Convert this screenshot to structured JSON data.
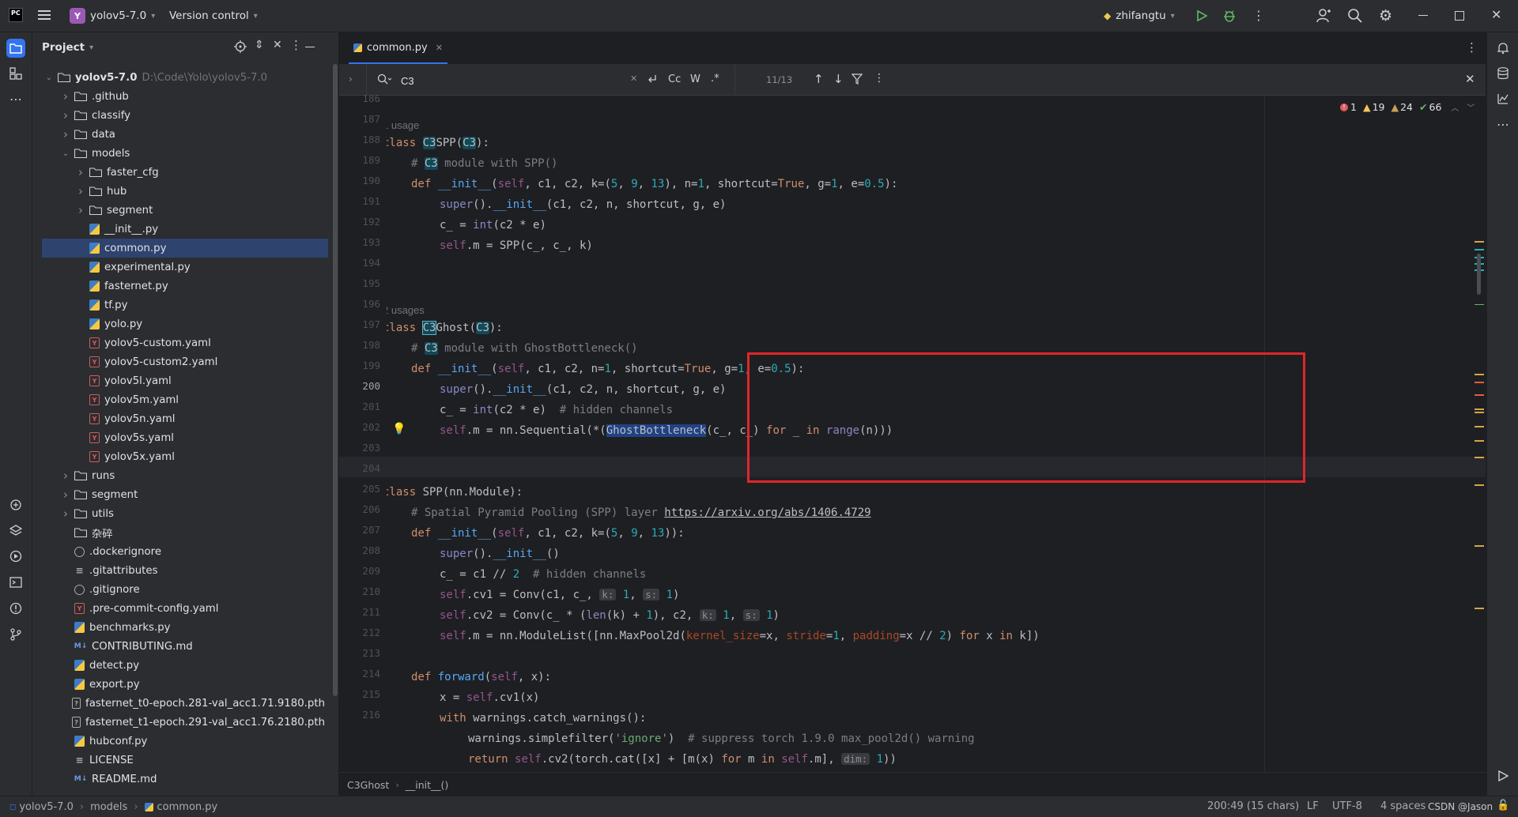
{
  "topbar": {
    "ide_logo": "PC",
    "project_badge": "Y",
    "project_name": "yolov5-7.0",
    "vcs": "Version control",
    "run_config": "zhifangtu"
  },
  "project_panel": {
    "title": "Project",
    "root_name": "yolov5-7.0",
    "root_path": "D:\\Code\\Yolo\\yolov5-7.0",
    "items": [
      {
        "label": ".github",
        "type": "folder",
        "depth": 1,
        "expand": "collapsed"
      },
      {
        "label": "classify",
        "type": "folder",
        "depth": 1,
        "expand": "collapsed"
      },
      {
        "label": "data",
        "type": "folder",
        "depth": 1,
        "expand": "collapsed"
      },
      {
        "label": "models",
        "type": "folder",
        "depth": 1,
        "expand": "expanded"
      },
      {
        "label": "faster_cfg",
        "type": "folder",
        "depth": 2,
        "expand": "collapsed"
      },
      {
        "label": "hub",
        "type": "folder",
        "depth": 2,
        "expand": "collapsed"
      },
      {
        "label": "segment",
        "type": "folder",
        "depth": 2,
        "expand": "collapsed"
      },
      {
        "label": "__init__.py",
        "type": "py",
        "depth": 2
      },
      {
        "label": "common.py",
        "type": "py",
        "depth": 2,
        "selected": true
      },
      {
        "label": "experimental.py",
        "type": "py",
        "depth": 2
      },
      {
        "label": "fasternet.py",
        "type": "py",
        "depth": 2
      },
      {
        "label": "tf.py",
        "type": "py",
        "depth": 2
      },
      {
        "label": "yolo.py",
        "type": "py",
        "depth": 2
      },
      {
        "label": "yolov5-custom.yaml",
        "type": "yaml",
        "depth": 2
      },
      {
        "label": "yolov5-custom2.yaml",
        "type": "yaml",
        "depth": 2
      },
      {
        "label": "yolov5l.yaml",
        "type": "yaml",
        "depth": 2
      },
      {
        "label": "yolov5m.yaml",
        "type": "yaml",
        "depth": 2
      },
      {
        "label": "yolov5n.yaml",
        "type": "yaml",
        "depth": 2
      },
      {
        "label": "yolov5s.yaml",
        "type": "yaml",
        "depth": 2
      },
      {
        "label": "yolov5x.yaml",
        "type": "yaml",
        "depth": 2
      },
      {
        "label": "runs",
        "type": "folder",
        "depth": 1,
        "expand": "collapsed"
      },
      {
        "label": "segment",
        "type": "folder",
        "depth": 1,
        "expand": "collapsed"
      },
      {
        "label": "utils",
        "type": "folder",
        "depth": 1,
        "expand": "collapsed"
      },
      {
        "label": "杂碎",
        "type": "folder",
        "depth": 1,
        "expand": "none"
      },
      {
        "label": ".dockerignore",
        "type": "ignore",
        "depth": 1
      },
      {
        "label": ".gitattributes",
        "type": "txt",
        "depth": 1
      },
      {
        "label": ".gitignore",
        "type": "ignore",
        "depth": 1
      },
      {
        "label": ".pre-commit-config.yaml",
        "type": "yaml",
        "depth": 1
      },
      {
        "label": "benchmarks.py",
        "type": "py",
        "depth": 1
      },
      {
        "label": "CONTRIBUTING.md",
        "type": "md",
        "depth": 1
      },
      {
        "label": "detect.py",
        "type": "py",
        "depth": 1
      },
      {
        "label": "export.py",
        "type": "py",
        "depth": 1
      },
      {
        "label": "fasternet_t0-epoch.281-val_acc1.71.9180.pth",
        "type": "pth",
        "depth": 1
      },
      {
        "label": "fasternet_t1-epoch.291-val_acc1.76.2180.pth",
        "type": "pth",
        "depth": 1
      },
      {
        "label": "hubconf.py",
        "type": "py",
        "depth": 1
      },
      {
        "label": "LICENSE",
        "type": "txt",
        "depth": 1
      },
      {
        "label": "README.md",
        "type": "md",
        "depth": 1
      }
    ]
  },
  "editor": {
    "tab_label": "common.py",
    "find": {
      "query": "C3",
      "count": "11/13",
      "match_case": "Cc",
      "words": "W",
      "regex": ".*"
    },
    "inspections": {
      "errors": "1",
      "warnings": "19",
      "weak": "24",
      "ok": "66"
    },
    "usage_hint_1": "1 usage",
    "usage_hint_2": "2 usages",
    "line_numbers": [
      "186",
      "187",
      "188",
      "189",
      "190",
      "191",
      "192",
      "193",
      "194",
      "195",
      "196",
      "197",
      "198",
      "199",
      "200",
      "201",
      "202",
      "203",
      "204",
      "205",
      "206",
      "207",
      "208",
      "209",
      "210",
      "211",
      "212",
      "213",
      "214",
      "215",
      "216"
    ],
    "current_line": "200",
    "breadcrumb": [
      "C3Ghost",
      "__init__()"
    ],
    "url": "https://arxiv.org/abs/1406.4729"
  },
  "status": {
    "path": [
      "yolov5-7.0",
      "models",
      "common.py"
    ],
    "position": "200:49 (15 chars)",
    "line_sep": "LF",
    "encoding": "UTF-8",
    "indent": "4 spaces",
    "watermark": "CSDN @Jason"
  },
  "colors": {
    "accent": "#3574f0",
    "highlight_box": "#e0262a",
    "selection": "#2e436e"
  }
}
